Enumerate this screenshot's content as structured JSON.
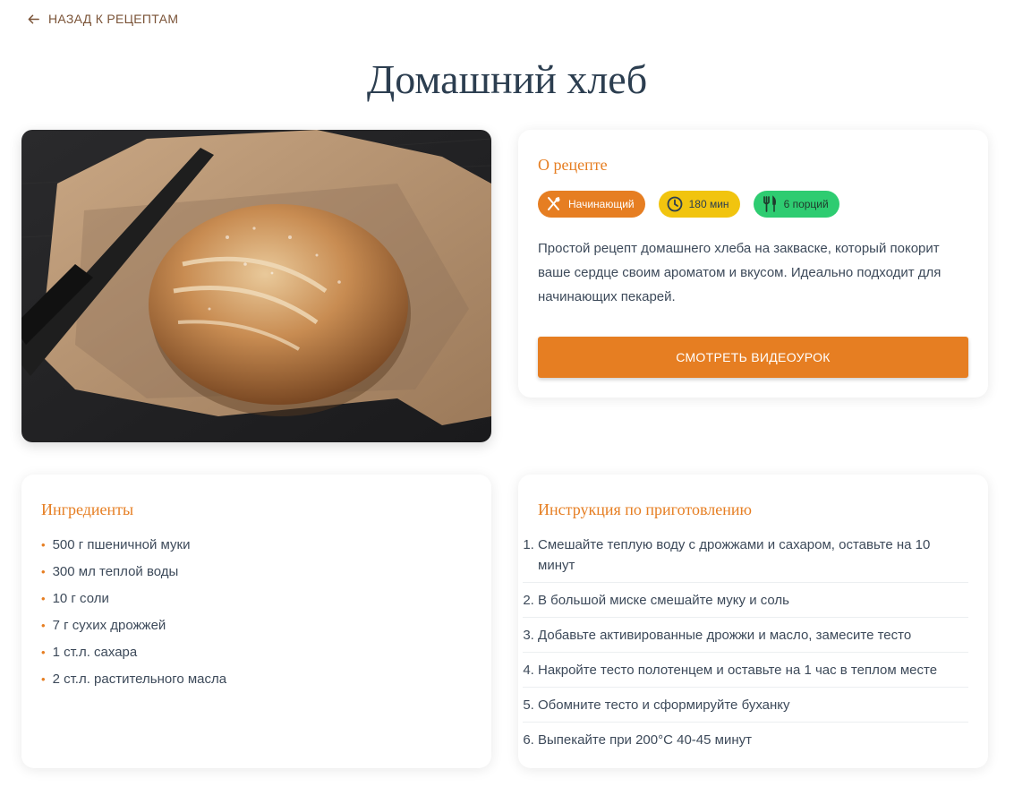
{
  "nav": {
    "back_label": "НАЗАД К РЕЦЕПТАМ",
    "back_icon": "arrow-left-icon"
  },
  "recipe": {
    "title": "Домашний хлеб",
    "image_alt": "Домашний хлеб на пергаменте"
  },
  "about": {
    "title": "О рецепте",
    "badges": {
      "level": {
        "label": "Начинающий",
        "icon": "utensils-icon",
        "color": "#e67e22"
      },
      "time": {
        "label": "180 мин",
        "icon": "clock-icon",
        "color": "#f1c40f"
      },
      "servings": {
        "label": "6 порций",
        "icon": "fork-knife-icon",
        "color": "#2ecc71"
      }
    },
    "description": "Простой рецепт домашнего хлеба на закваске, который покорит ваше сердце своим ароматом и вкусом. Идеально подходит для начинающих пекарей.",
    "video_button": "СМОТРЕТЬ ВИДЕОУРОК"
  },
  "ingredients": {
    "title": "Ингредиенты",
    "items": [
      "500 г пшеничной муки",
      "300 мл теплой воды",
      "10 г соли",
      "7 г сухих дрожжей",
      "1 ст.л. сахара",
      "2 ст.л. растительного масла"
    ]
  },
  "instructions": {
    "title": "Инструкция по приготовлению",
    "steps": [
      {
        "num": "1.",
        "text": "Смешайте теплую воду с дрожжами и сахаром, оставьте на 10 минут"
      },
      {
        "num": "2.",
        "text": "В большой миске смешайте муку и соль"
      },
      {
        "num": "3.",
        "text": "Добавьте активированные дрожжи и масло, замесите тесто"
      },
      {
        "num": "4.",
        "text": "Накройте тесто полотенцем и оставьте на 1 час в теплом месте"
      },
      {
        "num": "5.",
        "text": "Обомните тесто и сформируйте буханку"
      },
      {
        "num": "6.",
        "text": "Выпекайте при 200°C 40-45 минут"
      }
    ]
  },
  "colors": {
    "accent": "#e67e22",
    "title": "#2c3e50",
    "text": "#3d4a5a"
  }
}
